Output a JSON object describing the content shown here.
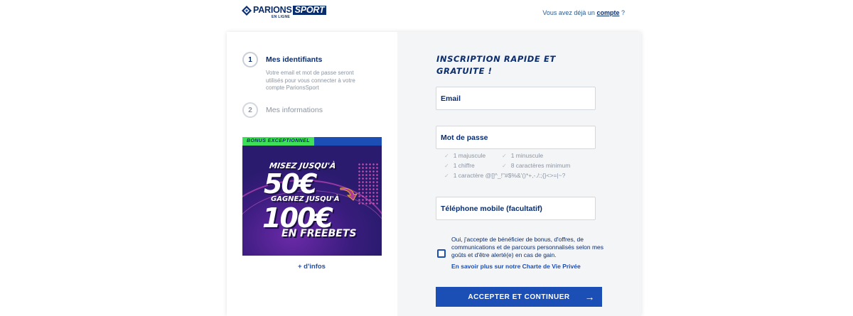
{
  "header": {
    "logo_main": "PARIONS",
    "logo_sport": "SPORT",
    "logo_sub": "EN LIGNE",
    "account_prefix": "Vous avez déjà un",
    "account_link": "compte",
    "account_suffix": "?"
  },
  "steps": [
    {
      "number": "1",
      "title": "Mes identifiants",
      "description": "Votre email et mot de passe seront utilisés pour vous connecter à votre compte ParionsSport"
    },
    {
      "number": "2",
      "title": "Mes informations"
    }
  ],
  "banner": {
    "tag": "BONUS EXCEPTIONNEL",
    "line1": "MISEZ JUSQU'À",
    "amount1": "50€",
    "line2": "GAGNEZ JUSQU'À",
    "amount2": "100€",
    "line3": "EN FREEBETS"
  },
  "more_info": "+ d'infos",
  "form": {
    "title": "INSCRIPTION RAPIDE ET GRATUITE !",
    "email_label": "Email",
    "password_label": "Mot de passe",
    "rules": {
      "uppercase": "1 majuscule",
      "lowercase": "1 minuscule",
      "digit": "1 chiffre",
      "length": "8 caractères minimum",
      "special": "1 caractère @[]^_!\"#$%&'()*+,-./:;{}<>=|~?"
    },
    "phone_label": "Téléphone mobile (facultatif)",
    "consent_text": "Oui, j'accepte de bénéficier de bonus, d'offres, de communications et de parcours personnalisés selon mes goûts et d'être alerté(e) en cas de gain.",
    "privacy_link": "En savoir plus sur notre Charte de Vie Privée",
    "submit_label": "ACCEPTER ET CONTINUER",
    "submit_arrow": "→",
    "check_glyph": "✓"
  },
  "colors": {
    "brand_navy": "#0a2d6e",
    "accent_blue": "#1b4fb5",
    "bonus_green": "#3ee05a",
    "panel_bg": "#f4f5f7"
  }
}
